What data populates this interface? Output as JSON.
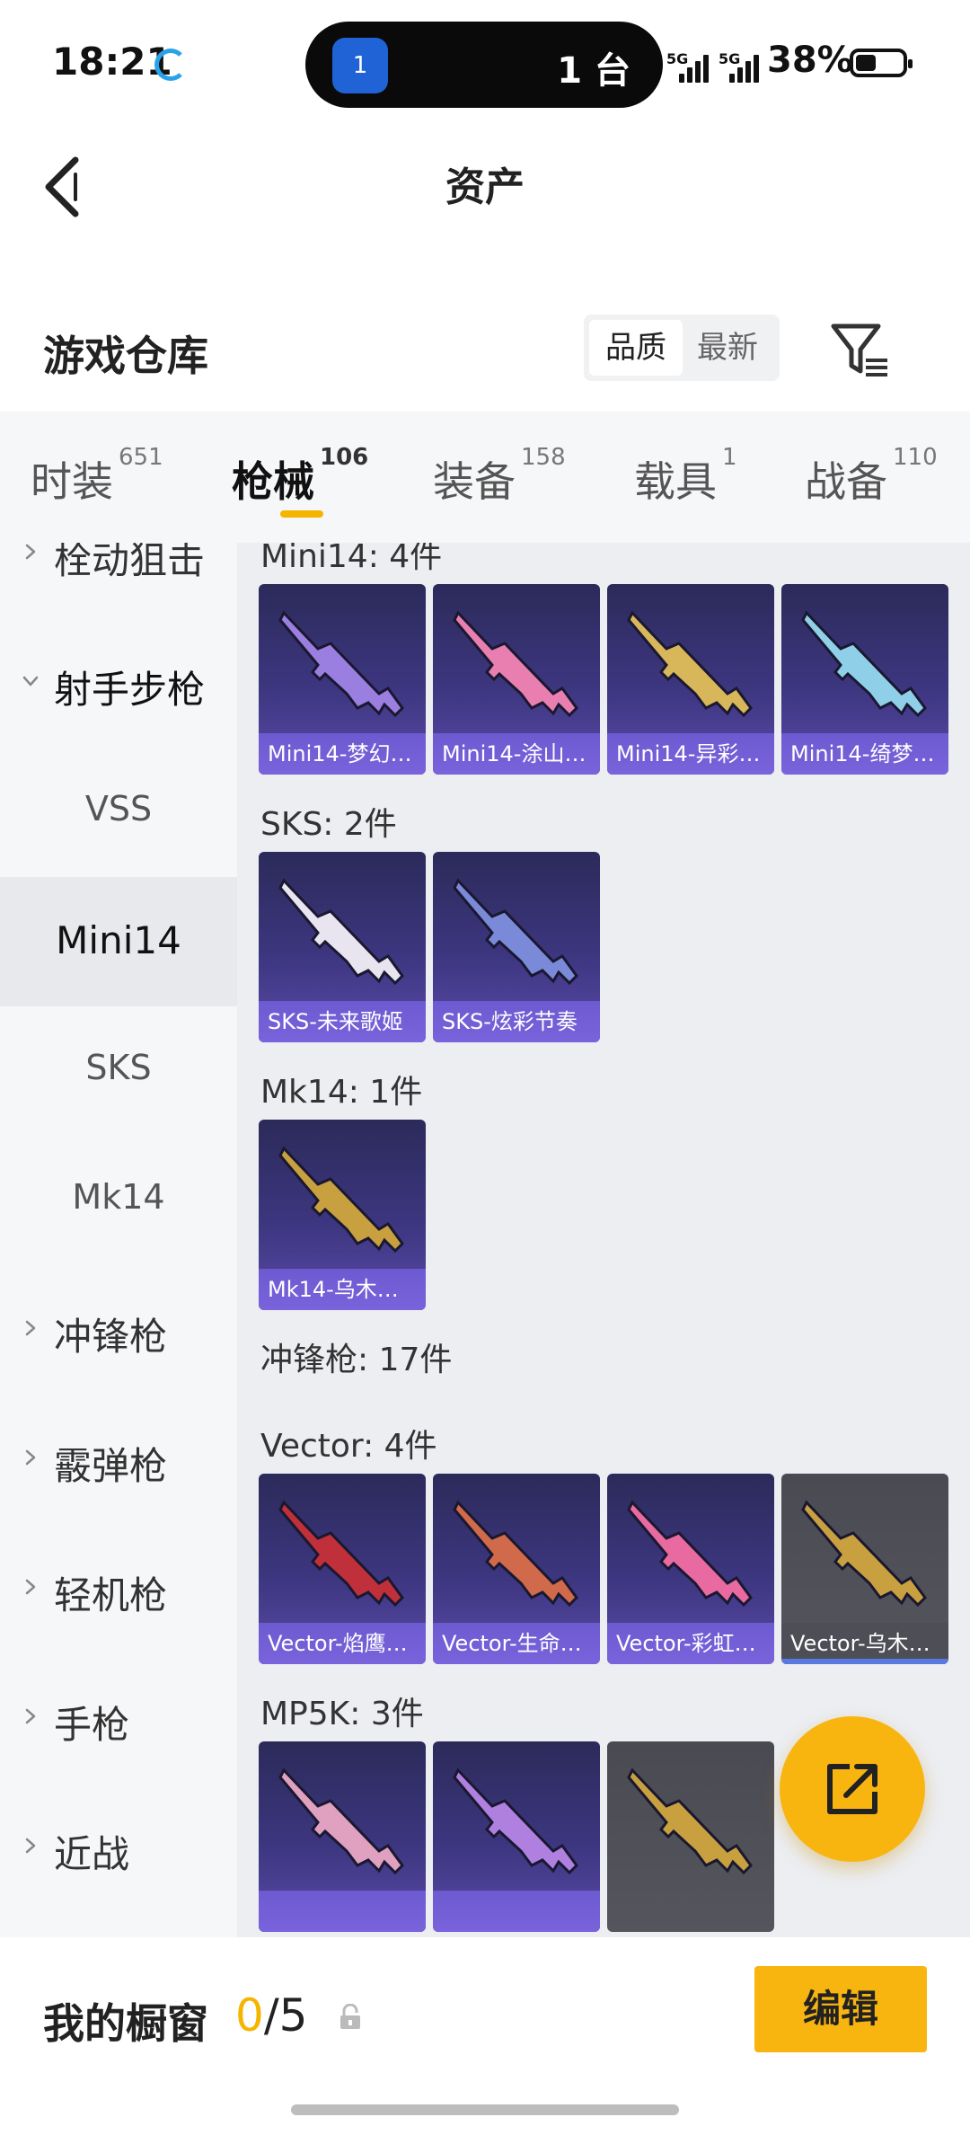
{
  "status_bar": {
    "time": "18:21",
    "pill_icon_text": "1",
    "pill_text": "1 台",
    "signal1": "5G",
    "signal2": "5G",
    "battery": "38%"
  },
  "header": {
    "title": "资产"
  },
  "warehouse": {
    "title": "游戏仓库",
    "sort_options": [
      "品质",
      "最新"
    ],
    "selected_sort": "品质"
  },
  "tabs": [
    {
      "label": "时装",
      "count": "651"
    },
    {
      "label": "枪械",
      "count": "106",
      "active": true
    },
    {
      "label": "装备",
      "count": "158"
    },
    {
      "label": "载具",
      "count": "1"
    },
    {
      "label": "战备",
      "count": "110"
    }
  ],
  "sidebar": [
    {
      "label": "栓动狙击",
      "kind": "category"
    },
    {
      "label": "射手步枪",
      "kind": "category",
      "expanded": true
    },
    {
      "label": "VSS",
      "kind": "sub"
    },
    {
      "label": "Mini14",
      "kind": "sub",
      "selected": true
    },
    {
      "label": "SKS",
      "kind": "sub"
    },
    {
      "label": "Mk14",
      "kind": "sub"
    },
    {
      "label": "冲锋枪",
      "kind": "category"
    },
    {
      "label": "霰弹枪",
      "kind": "category"
    },
    {
      "label": "轻机枪",
      "kind": "category"
    },
    {
      "label": "手枪",
      "kind": "category"
    },
    {
      "label": "近战",
      "kind": "category"
    }
  ],
  "groups": [
    {
      "title": "Mini14: 4件",
      "items": [
        {
          "name": "Mini14-梦幻…",
          "color": "#9a7fe0"
        },
        {
          "name": "Mini14-涂山…",
          "color": "#e87fb0"
        },
        {
          "name": "Mini14-异彩…",
          "color": "#d8b65a"
        },
        {
          "name": "Mini14-绮梦…",
          "color": "#8fd0e8"
        }
      ]
    },
    {
      "title": "SKS: 2件",
      "items": [
        {
          "name": "SKS-未来歌姬",
          "color": "#e8e4f0"
        },
        {
          "name": "SKS-炫彩节奏",
          "color": "#7a8ad8"
        }
      ]
    },
    {
      "title": "Mk14: 1件",
      "items": [
        {
          "name": "Mk14-乌木…",
          "color": "#c8a040"
        }
      ]
    },
    {
      "title": "冲锋枪: 17件",
      "items": []
    },
    {
      "title": "Vector: 4件",
      "items": [
        {
          "name": "Vector-焰鹰…",
          "color": "#c0303a"
        },
        {
          "name": "Vector-生命…",
          "color": "#d06a4a"
        },
        {
          "name": "Vector-彩虹…",
          "color": "#e86aa0"
        },
        {
          "name": "Vector-乌木…",
          "color": "#c9a040",
          "grey": true
        }
      ]
    },
    {
      "title": "MP5K: 3件",
      "items": [
        {
          "name": "",
          "color": "#e0a0c0"
        },
        {
          "name": "",
          "color": "#b080e0"
        },
        {
          "name": "",
          "color": "#c9a040",
          "grey": true
        }
      ]
    }
  ],
  "bottom": {
    "showcase_label": "我的橱窗",
    "current": "0",
    "total": "/5",
    "edit_label": "编辑"
  }
}
